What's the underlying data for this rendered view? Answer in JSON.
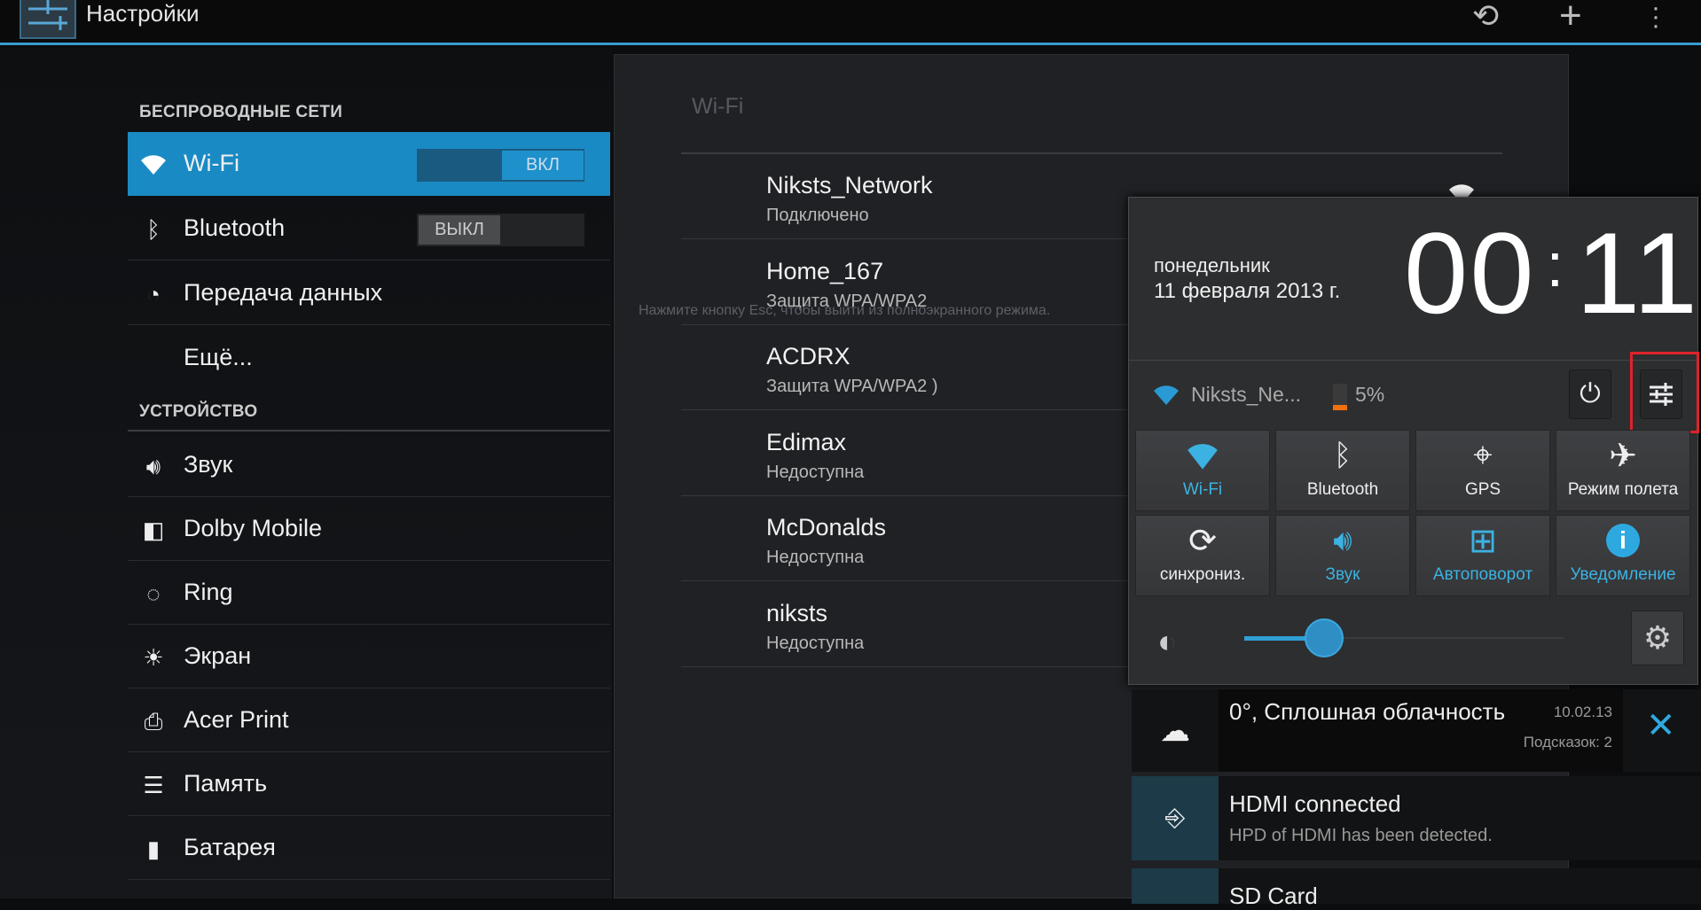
{
  "topbar": {
    "title": "Настройки",
    "icons": [
      "settings-app-icon",
      "sync-icon",
      "add-icon",
      "overflow-menu-icon"
    ]
  },
  "sidebar": {
    "section_wireless": "БЕСПРОВОДНЫЕ СЕТИ",
    "section_device": "УСТРОЙСТВО",
    "wireless": [
      {
        "label": "Wi-Fi",
        "icon": "wifi-icon",
        "toggle": "ВКЛ",
        "toggle_on": true
      },
      {
        "label": "Bluetooth",
        "icon": "bluetooth-icon",
        "toggle": "ВЫКЛ",
        "toggle_on": false
      },
      {
        "label": "Передача данных",
        "icon": "data-usage-icon"
      },
      {
        "label": "Ещё...",
        "icon": ""
      }
    ],
    "device": [
      {
        "label": "Звук",
        "icon": "sound-icon"
      },
      {
        "label": "Dolby Mobile",
        "icon": "dolby-icon"
      },
      {
        "label": "Ring",
        "icon": "ring-icon"
      },
      {
        "label": "Экран",
        "icon": "display-icon"
      },
      {
        "label": "Acer Print",
        "icon": "printer-icon"
      },
      {
        "label": "Память",
        "icon": "storage-icon"
      },
      {
        "label": "Батарея",
        "icon": "battery-icon"
      }
    ]
  },
  "main": {
    "title": "Wi-Fi",
    "networks": [
      {
        "name": "Niksts_Network",
        "status": "Подключено"
      },
      {
        "name": "Home_167",
        "status": "Защита WPA/WPA2"
      },
      {
        "name": "ACDRX",
        "status": "Защита WPA/WPA2 )"
      },
      {
        "name": "Edimax",
        "status": "Недоступна"
      },
      {
        "name": "McDonalds",
        "status": "Недоступна"
      },
      {
        "name": "niksts",
        "status": "Недоступна"
      }
    ]
  },
  "overlay_hint": "Нажмите кнопку Esc, чтобы выйти из полноэкранного режима.",
  "quick_panel": {
    "day": "понедельник",
    "date": "11 февраля 2013 г.",
    "time_h": "00",
    "time_sep": ":",
    "time_m": "11",
    "ssid": "Niksts_Ne...",
    "battery": "5%",
    "battery_level": 0.05,
    "tiles": [
      {
        "label": "Wi-Fi",
        "icon": "wifi-icon",
        "on": true
      },
      {
        "label": "Bluetooth",
        "icon": "bluetooth-icon",
        "on": false
      },
      {
        "label": "GPS",
        "icon": "gps-icon",
        "on": false
      },
      {
        "label": "Режим полета",
        "icon": "airplane-icon",
        "on": false
      },
      {
        "label": "синхрониз.",
        "icon": "sync-icon",
        "on": false
      },
      {
        "label": "Звук",
        "icon": "sound-icon",
        "on": true
      },
      {
        "label": "Автоповорот",
        "icon": "rotate-icon",
        "on": true
      },
      {
        "label": "Уведомление",
        "icon": "info-icon",
        "on": true
      }
    ],
    "brightness": 0.25
  },
  "notifications": [
    {
      "title": "0°, Сплошная облачность",
      "time": "10.02.13",
      "sub": "Подсказок: 2",
      "icon": "cloud-icon"
    },
    {
      "title": "HDMI connected",
      "sub": "HPD of HDMI has been detected.",
      "icon": "hdmi-icon"
    },
    {
      "title": "SD Card",
      "icon": "sd-card-icon"
    }
  ],
  "colors": {
    "accent": "#1a8ac4",
    "highlight": "#e0222a"
  }
}
